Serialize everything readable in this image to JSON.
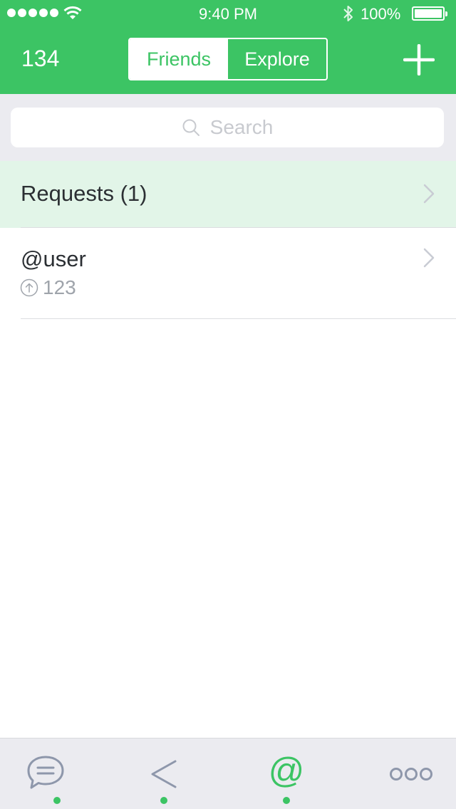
{
  "status_bar": {
    "time": "9:40 PM",
    "battery_percent": "100%",
    "signal_dots": 5,
    "icons": [
      "signal-dots-icon",
      "wifi-icon",
      "bluetooth-icon",
      "battery-icon"
    ]
  },
  "header": {
    "count": "134",
    "tabs": [
      {
        "label": "Friends",
        "active": true
      },
      {
        "label": "Explore",
        "active": false
      }
    ],
    "add_icon": "plus-icon"
  },
  "search": {
    "placeholder": "Search",
    "icon": "search-icon"
  },
  "list": {
    "requests": {
      "label": "Requests (1)",
      "icon": "chevron-right-icon"
    },
    "items": [
      {
        "username": "@user",
        "score": "123",
        "score_icon": "arrow-up-circle-icon",
        "icon": "chevron-right-icon"
      }
    ]
  },
  "tab_bar": {
    "items": [
      {
        "icon": "chat-bubble-icon",
        "has_dot": true
      },
      {
        "icon": "back-chevron-icon",
        "has_dot": true
      },
      {
        "icon": "at-sign-icon",
        "has_dot": true,
        "active": true
      },
      {
        "icon": "more-dots-icon",
        "has_dot": false
      }
    ]
  },
  "colors": {
    "brand_green": "#3cc464",
    "requests_bg": "#e2f5e8",
    "tab_bar_bg": "#ebebf0",
    "inactive_icon": "#8e97ab"
  }
}
